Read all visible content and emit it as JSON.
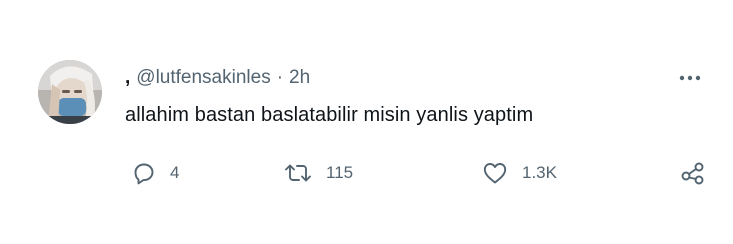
{
  "tweet": {
    "display_name": ",",
    "handle": "@lutfensakinles",
    "separator": "·",
    "time": "2h",
    "text": "allahim bastan baslatabilir misin yanlis yaptim"
  },
  "actions": {
    "reply_count": "4",
    "retweet_count": "115",
    "like_count": "1.3K"
  },
  "icons": {
    "more": "more-horizontal-icon",
    "reply": "reply-icon",
    "retweet": "retweet-icon",
    "like": "heart-icon",
    "share": "share-icon"
  },
  "colors": {
    "text": "#0f1419",
    "secondary": "#536471",
    "background": "#ffffff"
  }
}
